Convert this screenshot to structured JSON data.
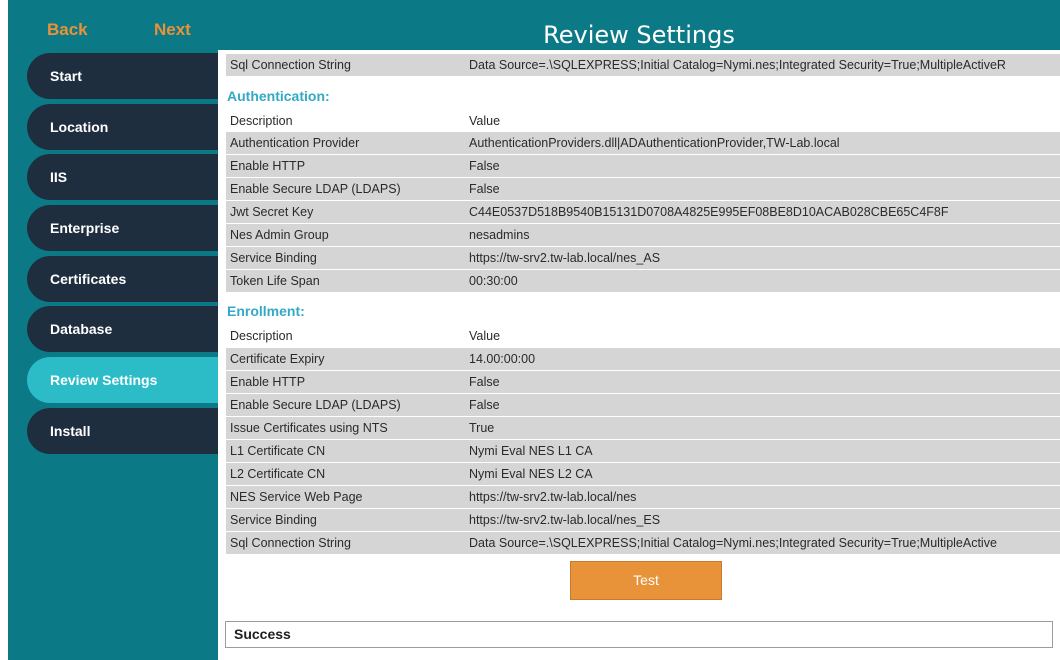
{
  "nav": {
    "back_label": "Back",
    "next_label": "Next",
    "title": "Review Settings"
  },
  "sidebar": {
    "items": [
      {
        "label": "Start",
        "active": false
      },
      {
        "label": "Location",
        "active": false
      },
      {
        "label": "IIS",
        "active": false
      },
      {
        "label": "Enterprise",
        "active": false
      },
      {
        "label": "Certificates",
        "active": false
      },
      {
        "label": "Database",
        "active": false
      },
      {
        "label": "Review Settings",
        "active": true
      },
      {
        "label": "Install",
        "active": false
      }
    ]
  },
  "database": {
    "rows": [
      {
        "description": "Sql Connection String",
        "value": "Data Source=.\\SQLEXPRESS;Initial Catalog=Nymi.nes;Integrated Security=True;MultipleActiveR"
      }
    ]
  },
  "authentication": {
    "title": "Authentication:",
    "header": {
      "description": "Description",
      "value": "Value"
    },
    "rows": [
      {
        "description": "Authentication Provider",
        "value": "AuthenticationProviders.dll|ADAuthenticationProvider,TW-Lab.local"
      },
      {
        "description": "Enable HTTP",
        "value": "False"
      },
      {
        "description": "Enable Secure LDAP (LDAPS)",
        "value": "False"
      },
      {
        "description": "Jwt Secret Key",
        "value": "C44E0537D518B9540B15131D0708A4825E995EF08BE8D10ACAB028CBE65C4F8F"
      },
      {
        "description": "Nes Admin Group",
        "value": "nesadmins"
      },
      {
        "description": "Service Binding",
        "value": "https://tw-srv2.tw-lab.local/nes_AS"
      },
      {
        "description": "Token Life Span",
        "value": "00:30:00"
      }
    ]
  },
  "enrollment": {
    "title": "Enrollment:",
    "header": {
      "description": "Description",
      "value": "Value"
    },
    "rows": [
      {
        "description": "Certificate Expiry",
        "value": "14.00:00:00"
      },
      {
        "description": "Enable HTTP",
        "value": "False"
      },
      {
        "description": "Enable Secure LDAP (LDAPS)",
        "value": "False"
      },
      {
        "description": "Issue Certificates using NTS",
        "value": "True"
      },
      {
        "description": "L1 Certificate CN",
        "value": "Nymi Eval NES L1 CA"
      },
      {
        "description": "L2 Certificate CN",
        "value": "Nymi Eval NES L2 CA"
      },
      {
        "description": "NES Service Web Page",
        "value": "https://tw-srv2.tw-lab.local/nes"
      },
      {
        "description": "Service Binding",
        "value": "https://tw-srv2.tw-lab.local/nes_ES"
      },
      {
        "description": "Sql Connection String",
        "value": "Data Source=.\\SQLEXPRESS;Initial Catalog=Nymi.nes;Integrated Security=True;MultipleActive"
      }
    ]
  },
  "actions": {
    "test_label": "Test"
  },
  "status": {
    "text": "Success"
  },
  "colors": {
    "teal": "#0c7a86",
    "nav_dark": "#1f2e3f",
    "nav_active": "#2cbcc8",
    "accent_orange": "#e8923a",
    "section_title": "#33a9c5",
    "row_shade": "#d5d5d5"
  }
}
